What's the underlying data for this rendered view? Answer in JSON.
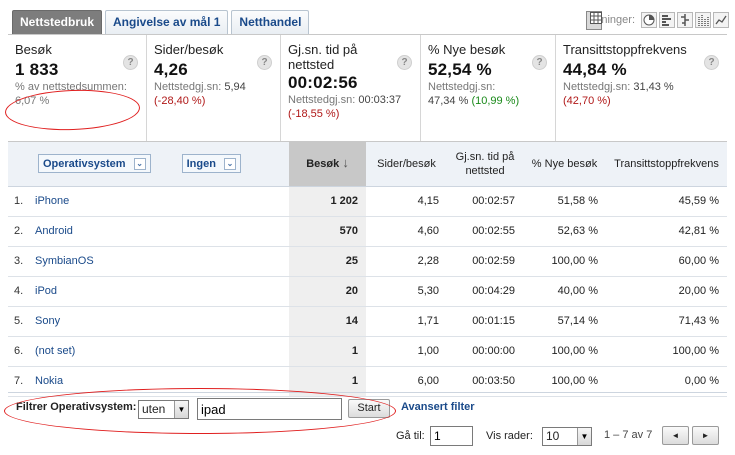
{
  "tabs": [
    {
      "label": "Nettstedbruk",
      "active": true
    },
    {
      "label": "Angivelse av mål 1",
      "active": false
    },
    {
      "label": "Netthandel",
      "active": false
    }
  ],
  "views": {
    "label": "Visninger:",
    "icons": [
      "table-icon",
      "pie-icon",
      "bar-icon",
      "compare-icon",
      "pivot-icon",
      "trend-icon"
    ],
    "selected": "table-icon"
  },
  "scorecard": [
    {
      "name": "Besøk",
      "value": "1 833",
      "sub1": "% av nettstedsummen:",
      "sub2": "6,07 %",
      "help": "?"
    },
    {
      "name": "Sider/besøk",
      "value": "4,26",
      "sub1_label": "Nettstedgj.sn:",
      "sub1_value": "5,94",
      "change": "(-28,40 %)",
      "change_type": "neg",
      "help": "?"
    },
    {
      "name": "Gj.sn. tid på nettsted",
      "value": "00:02:56",
      "sub1_label": "Nettstedgj.sn:",
      "sub1_value": "00:03:37",
      "change": "(-18,55 %)",
      "change_type": "neg",
      "help": "?"
    },
    {
      "name": "% Nye besøk",
      "value": "52,54 %",
      "sub1_label": "Nettstedgj.sn:",
      "sub1_value": "47,34 %",
      "change": "(10,99 %)",
      "change_type": "pos",
      "help": "?"
    },
    {
      "name": "Transittstoppfrekvens",
      "value": "44,84 %",
      "sub1_label": "Nettstedgj.sn:",
      "sub1_value": "31,43 %",
      "change": "(42,70 %)",
      "change_type": "neg",
      "help": "?"
    }
  ],
  "table": {
    "dimension1": "Operativsystem",
    "dimension2": "Ingen",
    "columns": [
      "Besøk",
      "Sider/besøk",
      "Gj.sn. tid på nettsted",
      "% Nye besøk",
      "Transittstoppfrekvens"
    ],
    "sort_arrow": "↓",
    "rows": [
      {
        "idx": "1.",
        "name": "iPhone",
        "besok": "1 202",
        "sider": "4,15",
        "tid": "00:02:57",
        "nye": "51,58 %",
        "transitt": "45,59 %"
      },
      {
        "idx": "2.",
        "name": "Android",
        "besok": "570",
        "sider": "4,60",
        "tid": "00:02:55",
        "nye": "52,63 %",
        "transitt": "42,81 %"
      },
      {
        "idx": "3.",
        "name": "SymbianOS",
        "besok": "25",
        "sider": "2,28",
        "tid": "00:02:59",
        "nye": "100,00 %",
        "transitt": "60,00 %"
      },
      {
        "idx": "4.",
        "name": "iPod",
        "besok": "20",
        "sider": "5,30",
        "tid": "00:04:29",
        "nye": "40,00 %",
        "transitt": "20,00 %"
      },
      {
        "idx": "5.",
        "name": "Sony",
        "besok": "14",
        "sider": "1,71",
        "tid": "00:01:15",
        "nye": "57,14 %",
        "transitt": "71,43 %"
      },
      {
        "idx": "6.",
        "name": "(not set)",
        "besok": "1",
        "sider": "1,00",
        "tid": "00:00:00",
        "nye": "100,00 %",
        "transitt": "100,00 %"
      },
      {
        "idx": "7.",
        "name": "Nokia",
        "besok": "1",
        "sider": "6,00",
        "tid": "00:03:50",
        "nye": "100,00 %",
        "transitt": "0,00 %"
      }
    ]
  },
  "filter": {
    "label": "Filtrer Operativsystem:",
    "mode": "uten",
    "value": "ipad",
    "start": "Start",
    "advanced": "Avansert filter"
  },
  "pagination": {
    "goto_label": "Gå til:",
    "goto_value": "1",
    "rows_label": "Vis rader:",
    "rows_value": "10",
    "range": "1 – 7 av 7",
    "prev": "◄",
    "next": "►"
  }
}
